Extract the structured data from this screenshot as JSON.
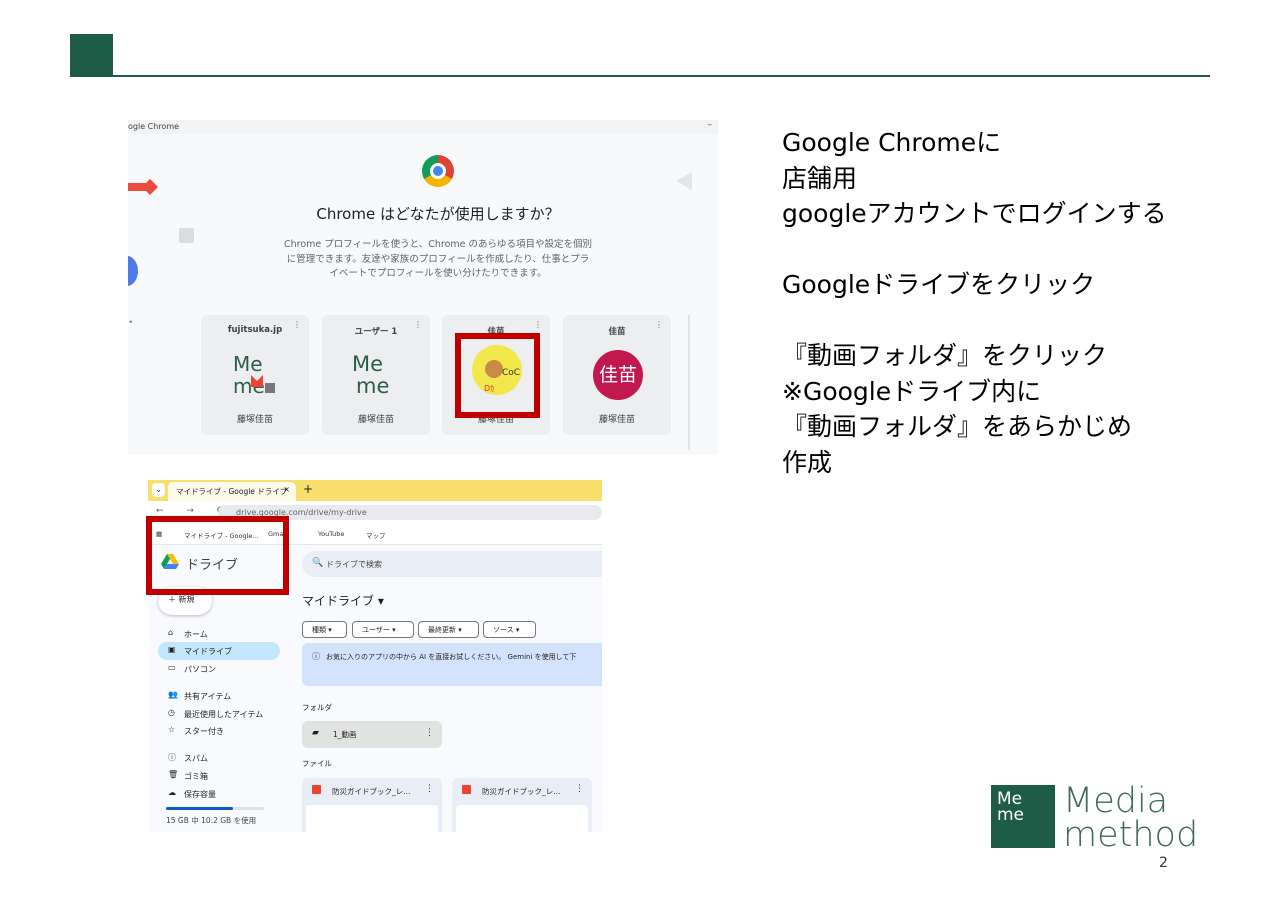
{
  "colors": {
    "brand_green": "#1f5c47",
    "highlight_red": "#c00000"
  },
  "profile_picker": {
    "window_title": "ogle Chrome",
    "minimize": "–",
    "question": "Chrome はどなたが使用しますか？",
    "description_lines": [
      "Chrome プロフィールを使うと、Chrome のあらゆる項目や設定を個別",
      "に管理できます。友達や家族のプロフィールを作成したり、仕事とプラ",
      "イベートでプロフィールを使い分けたりできます。"
    ],
    "stray_dot": "•",
    "profiles": [
      {
        "label": "fujitsuka.jp",
        "name": "藤塚佳苗",
        "avatar": "Me me logo"
      },
      {
        "label": "ユーザー 1",
        "name": "藤塚佳苗",
        "avatar": "Me me logo"
      },
      {
        "label": "佳苗",
        "name": "藤塚佳苗",
        "avatar": "yellow illustrated avatar"
      },
      {
        "label": "佳苗",
        "name": "藤塚佳苗",
        "avatar_text": "佳苗"
      }
    ],
    "card_menu": "⋮"
  },
  "drive": {
    "tab_title": "マイドライブ - Google ドライブ",
    "tab_close": "×",
    "tab_new": "+",
    "tab_dropdown": "⌄",
    "nav_glyphs": "← → C",
    "url": "drive.google.com/drive/my-drive",
    "bookmarks": [
      {
        "label": "マイドライブ - Google..."
      },
      {
        "label": "Gmail"
      },
      {
        "label": "YouTube"
      },
      {
        "label": "マップ"
      }
    ],
    "app_name": "ドライブ",
    "new_button": "新規",
    "nav": [
      {
        "label": "ホーム",
        "icon": "⌂"
      },
      {
        "label": "マイドライブ",
        "icon": "▣",
        "active": true
      },
      {
        "label": "パソコン",
        "icon": "▭"
      },
      {
        "label": "共有アイテム",
        "icon": "👥"
      },
      {
        "label": "最近使用したアイテム",
        "icon": "◷"
      },
      {
        "label": "スター付き",
        "icon": "☆"
      },
      {
        "label": "スパム",
        "icon": "ⓘ"
      },
      {
        "label": "ゴミ箱",
        "icon": "🗑"
      },
      {
        "label": "保存容量",
        "icon": "☁"
      }
    ],
    "storage": {
      "text": "15 GB 中 10.2 GB を使用",
      "used_fraction": 0.68
    },
    "search_placeholder": "ドライブで検索",
    "page_title": "マイドライブ ▾",
    "filters": [
      "種類 ▾",
      "ユーザー ▾",
      "最終更新 ▾",
      "ソース ▾"
    ],
    "banner": "お気に入りのアプリの中から AI を直接お試しください。 Gemini を使用して下",
    "folders_label": "フォルダ",
    "folder": "1_動画",
    "files_label": "ファイル",
    "files": [
      "防災ガイドブック_レ...",
      "防災ガイドブック_レ..."
    ]
  },
  "instructions": [
    "Google Chromeに",
    "店舗用",
    "googleアカウントでログインする",
    "",
    "Googleドライブをクリック",
    "",
    "『動画フォルダ』をクリック",
    "※Googleドライブ内に",
    "『動画フォルダ』をあらかじめ",
    "作成"
  ],
  "brand": {
    "square": [
      "Me",
      "me"
    ],
    "text_line1": "Media",
    "text_line2": "method"
  },
  "page_number": "2"
}
